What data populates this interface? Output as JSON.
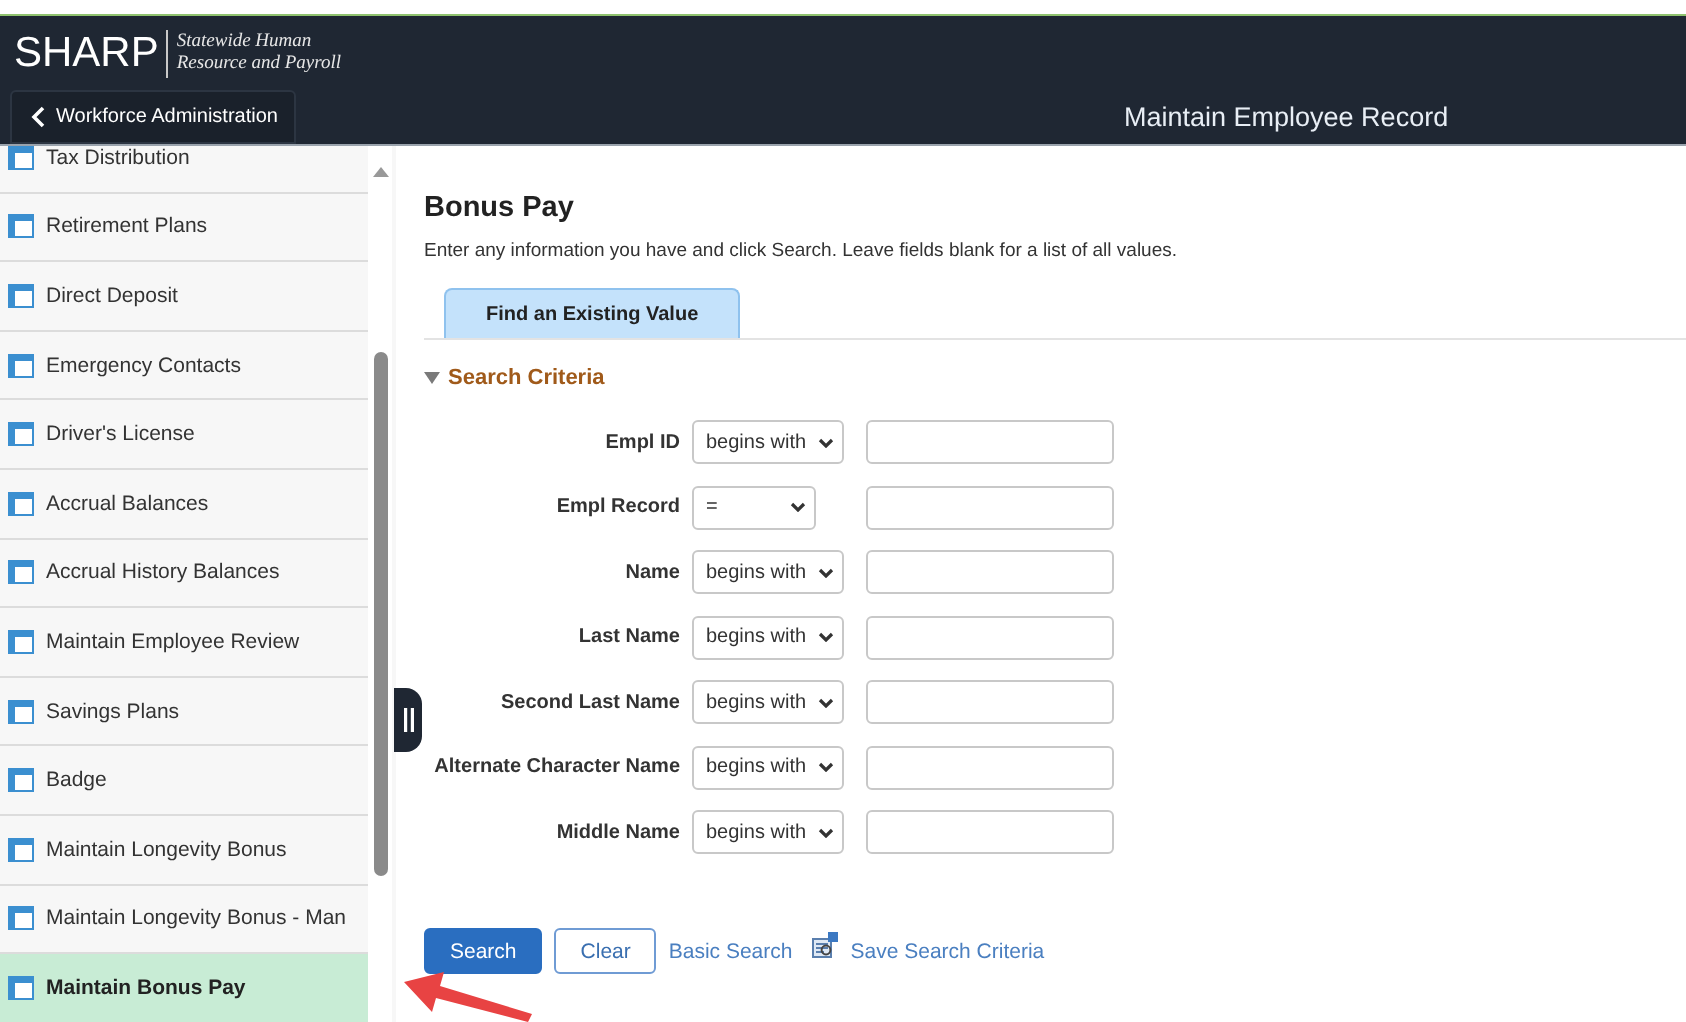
{
  "header": {
    "logo": "SHARP",
    "tagline": [
      "Statewide Human",
      "Resource and Payroll"
    ],
    "back_button": "Workforce Administration",
    "page_title": "Maintain Employee Record"
  },
  "sidebar": {
    "items": [
      {
        "label": "Tax Distribution",
        "selected": false
      },
      {
        "label": "Retirement Plans",
        "selected": false
      },
      {
        "label": "Direct Deposit",
        "selected": false
      },
      {
        "label": "Emergency Contacts",
        "selected": false
      },
      {
        "label": "Driver's License",
        "selected": false
      },
      {
        "label": "Accrual Balances",
        "selected": false
      },
      {
        "label": "Accrual History Balances",
        "selected": false
      },
      {
        "label": "Maintain Employee Review",
        "selected": false
      },
      {
        "label": "Savings Plans",
        "selected": false
      },
      {
        "label": "Badge",
        "selected": false
      },
      {
        "label": "Maintain Longevity Bonus",
        "selected": false
      },
      {
        "label": "Maintain Longevity Bonus - Man",
        "selected": false
      },
      {
        "label": "Maintain Bonus Pay",
        "selected": true
      }
    ]
  },
  "main": {
    "title": "Bonus Pay",
    "instructions": "Enter any information you have and click Search. Leave fields blank for a list of all values.",
    "tabs": [
      {
        "label": "Find an Existing Value",
        "selected": true
      }
    ],
    "section": {
      "title": "Search Criteria",
      "expanded": true
    },
    "fields": [
      {
        "label": "Empl ID",
        "operator": "begins with"
      },
      {
        "label": "Empl Record",
        "operator": "="
      },
      {
        "label": "Name",
        "operator": "begins with"
      },
      {
        "label": "Last Name",
        "operator": "begins with"
      },
      {
        "label": "Second Last Name",
        "operator": "begins with"
      },
      {
        "label": "Alternate Character Name",
        "operator": "begins with"
      },
      {
        "label": "Middle Name",
        "operator": "begins with"
      }
    ],
    "actions": [
      {
        "label": "Search",
        "kind": "primary"
      },
      {
        "label": "Clear",
        "kind": "secondary"
      },
      {
        "label": "Basic Search",
        "kind": "link"
      },
      {
        "label": "Save Search Criteria",
        "kind": "icon-link"
      }
    ]
  }
}
